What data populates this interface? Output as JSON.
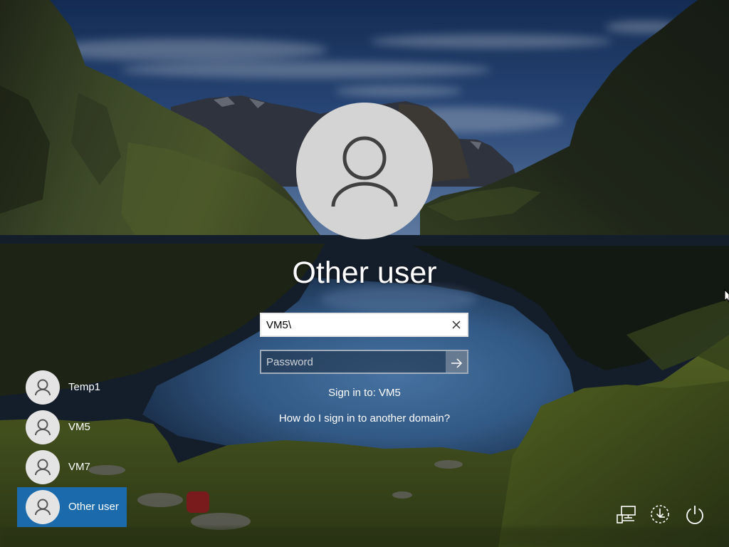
{
  "main": {
    "account_name": "Other user",
    "avatar_icon": "user-icon",
    "username_value": "VM5\\",
    "clear_icon": "close-icon",
    "password_placeholder": "Password",
    "submit_icon": "arrow-right-icon",
    "sign_in_to": "Sign in to: VM5",
    "domain_help_link": "How do I sign in to another domain?"
  },
  "user_list": [
    {
      "name": "Temp1",
      "icon": "user-icon",
      "selected": false
    },
    {
      "name": "VM5",
      "icon": "user-icon",
      "selected": false
    },
    {
      "name": "VM7",
      "icon": "user-icon",
      "selected": false
    },
    {
      "name": "Other user",
      "icon": "user-icon",
      "selected": true
    }
  ],
  "system_icons": [
    "network-icon",
    "ease-of-access-icon",
    "power-icon"
  ],
  "colors": {
    "selected_user_bg": "#1a6aac",
    "text": "#ffffff",
    "avatar_bg": "#d4d4d4",
    "avatar_glyph": "#404040"
  }
}
